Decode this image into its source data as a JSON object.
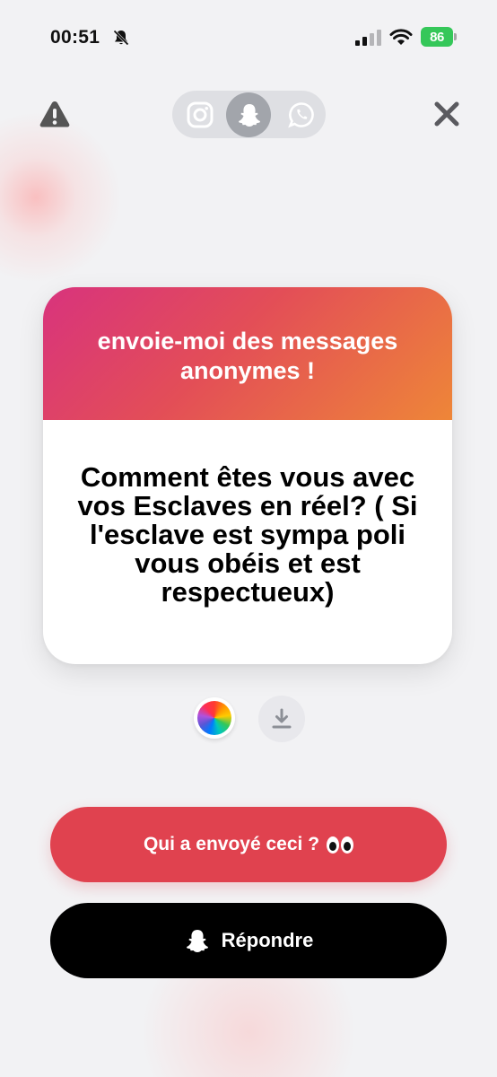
{
  "status_bar": {
    "time": "00:51",
    "battery": "86",
    "icons": [
      "bell-slash-icon",
      "signal-icon",
      "wifi-icon",
      "battery-icon"
    ]
  },
  "header": {
    "icons": [
      "warning-icon",
      "instagram-icon",
      "snapchat-icon",
      "whatsapp-icon",
      "close-icon"
    ],
    "selected_share": "snapchat"
  },
  "card": {
    "title": "envoie-moi des messages anonymes !",
    "question": "Comment êtes vous avec vos Esclaves en réel? ( Si l'esclave est sympa poli vous obéis et est respectueux)",
    "gradient_colors": [
      "#d8337d",
      "#e34e57",
      "#ee8638"
    ]
  },
  "tools": {
    "icons": [
      "color-wheel-icon",
      "download-icon"
    ]
  },
  "actions": {
    "who_label": "Qui a envoyé ceci ?",
    "reply_label": "Répondre",
    "who_color": "#e0424f",
    "reply_color": "#000000",
    "icons": [
      "eyes-icon",
      "snapchat-ghost-icon"
    ]
  }
}
